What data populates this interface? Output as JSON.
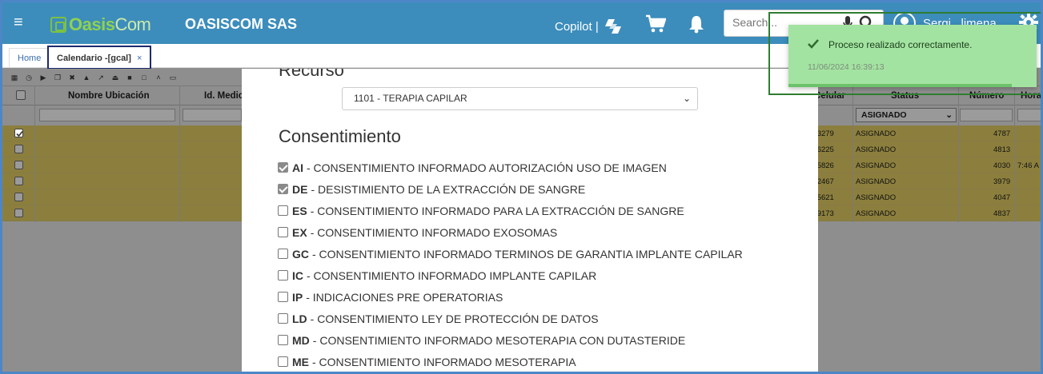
{
  "header": {
    "logo_part1": "Oasis",
    "logo_part2": "Com",
    "company": "OASISCOM SAS",
    "copilot_label": "Copilot |",
    "search_placeholder": "Search...",
    "user_name": "Sergi...limena",
    "brand_color": "#3c8dbc"
  },
  "tabs": [
    {
      "label": "Home"
    },
    {
      "label": "Calendario -[gcal]",
      "close": "×"
    }
  ],
  "grid": {
    "columns": {
      "ubicacion": "Nombre Ubicación",
      "medico": "Id. Medic",
      "celular": "Celular",
      "status": "Status",
      "numero": "Número",
      "hora": "Hora"
    },
    "status_filter": "ASIGNADO",
    "rows": [
      {
        "celular": "*3279",
        "status": "ASIGNADO",
        "numero": "4787",
        "hora": "",
        "checked": true
      },
      {
        "celular": "*6225",
        "status": "ASIGNADO",
        "numero": "4813",
        "hora": "",
        "checked": false
      },
      {
        "celular": "*5826",
        "status": "ASIGNADO",
        "numero": "4030",
        "hora": "7:46 A",
        "checked": false
      },
      {
        "celular": "*2467",
        "status": "ASIGNADO",
        "numero": "3979",
        "hora": "",
        "checked": false
      },
      {
        "celular": "*5621",
        "status": "ASIGNADO",
        "numero": "4047",
        "hora": "",
        "checked": false
      },
      {
        "celular": "*9173",
        "status": "ASIGNADO",
        "numero": "4837",
        "hora": "",
        "checked": false
      }
    ]
  },
  "modal": {
    "recurso_title": "Recurso",
    "recurso_value": "1101 - TERAPIA CAPILAR",
    "consent_title": "Consentimiento",
    "items": [
      {
        "code": "AI",
        "label": "- CONSENTIMIENTO INFORMADO AUTORIZACIÓN USO DE IMAGEN",
        "checked": true
      },
      {
        "code": "DE",
        "label": "- DESISTIMIENTO DE LA EXTRACCIÓN DE SANGRE",
        "checked": true
      },
      {
        "code": "ES",
        "label": "- CONSENTIMIENTO INFORMADO PARA LA EXTRACCIÓN DE SANGRE",
        "checked": false
      },
      {
        "code": "EX",
        "label": "- CONSENTIMIENTO INFORMADO EXOSOMAS",
        "checked": false
      },
      {
        "code": "GC",
        "label": "- CONSENTIMIENTO INFORMADO TERMINOS DE GARANTIA IMPLANTE CAPILAR",
        "checked": false
      },
      {
        "code": "IC",
        "label": "- CONSENTIMIENTO INFORMADO IMPLANTE CAPILAR",
        "checked": false
      },
      {
        "code": "IP",
        "label": "- INDICACIONES PRE OPERATORIAS",
        "checked": false
      },
      {
        "code": "LD",
        "label": "- CONSENTIMIENTO LEY DE PROTECCIÓN DE DATOS",
        "checked": false
      },
      {
        "code": "MD",
        "label": "- CONSENTIMIENTO INFORMADO MESOTERAPIA CON DUTASTERIDE",
        "checked": false
      },
      {
        "code": "ME",
        "label": "- CONSENTIMIENTO INFORMADO MESOTERAPIA",
        "checked": false
      }
    ]
  },
  "toast": {
    "message": "Proceso realizado correctamente.",
    "timestamp": "11/06/2024 16:39:13",
    "progress": 0.9,
    "color": "#a3e3a1"
  },
  "icons": [
    "hamburger-icon",
    "copilot-icon",
    "cart-icon",
    "bell-icon",
    "mic-icon",
    "search-icon",
    "user-avatar-icon",
    "gear-icon",
    "check-icon"
  ]
}
